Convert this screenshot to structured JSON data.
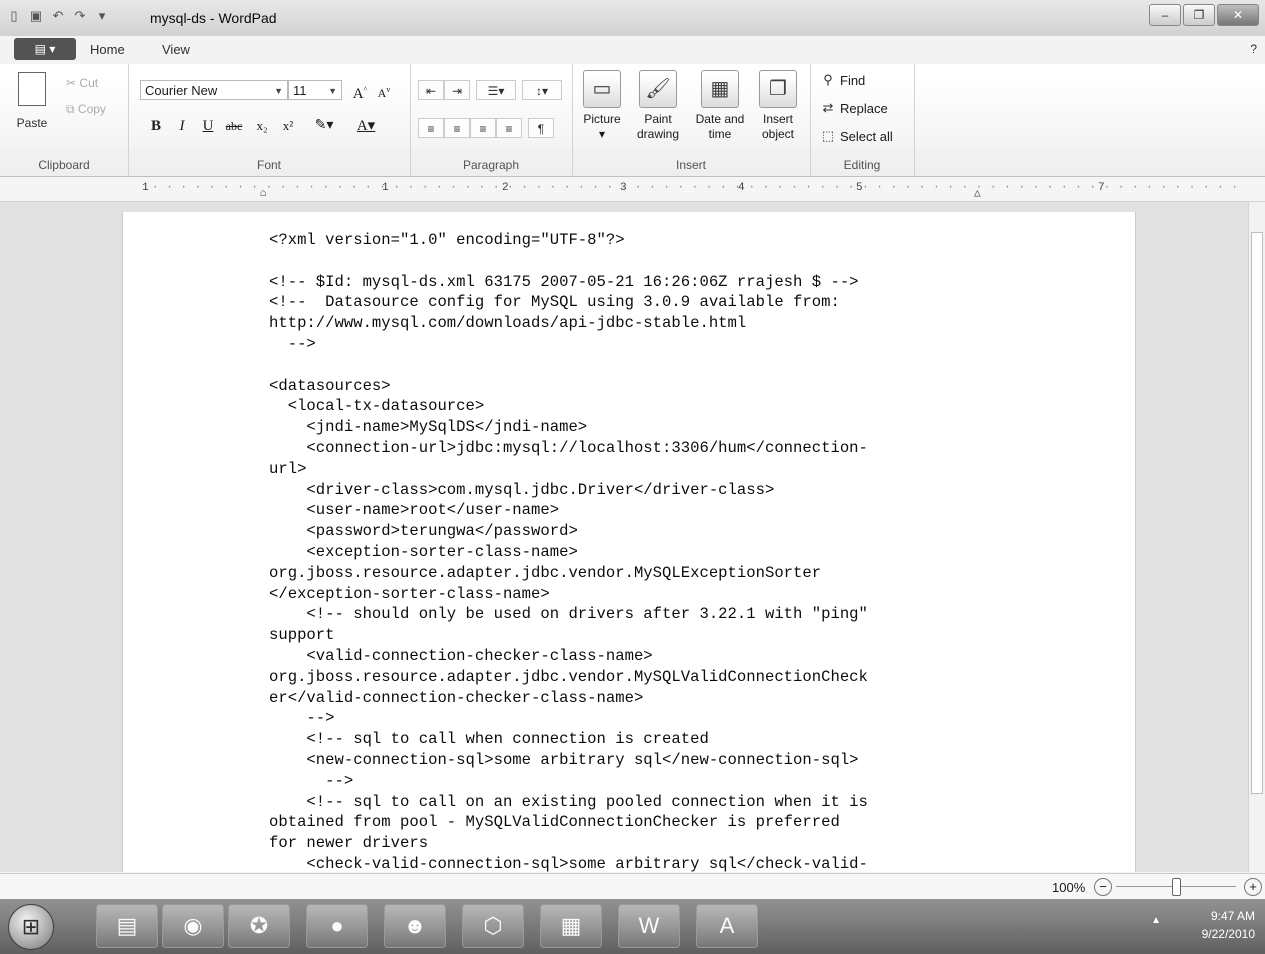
{
  "window": {
    "title": "mysql-ds - WordPad"
  },
  "tabs": {
    "home": "Home",
    "view": "View"
  },
  "ribbon": {
    "clipboard": {
      "paste": "Paste",
      "cut": "Cut",
      "copy": "Copy",
      "label": "Clipboard"
    },
    "font": {
      "family": "Courier New",
      "size": "11",
      "label": "Font"
    },
    "paragraph": {
      "label": "Paragraph"
    },
    "insert": {
      "picture": "Picture",
      "paint_drawing": "Paint drawing",
      "date_time": "Date and time",
      "insert_object": "Insert object",
      "label": "Insert"
    },
    "editing": {
      "find": "Find",
      "replace": "Replace",
      "select_all": "Select all",
      "label": "Editing"
    }
  },
  "ruler": {
    "numbers": [
      "1",
      "1",
      "2",
      "3",
      "4",
      "5",
      "7"
    ]
  },
  "document": {
    "lines": [
      "<?xml version=\"1.0\" encoding=\"UTF-8\"?>",
      "",
      "<!-- $Id: mysql-ds.xml 63175 2007-05-21 16:26:06Z rrajesh $ -->",
      "<!--  Datasource config for MySQL using 3.0.9 available from:",
      "http://www.mysql.com/downloads/api-jdbc-stable.html",
      "  -->",
      "",
      "<datasources>",
      "  <local-tx-datasource>",
      "    <jndi-name>MySqlDS</jndi-name>",
      "    <connection-url>jdbc:mysql://localhost:3306/hum</connection-",
      "url>",
      "    <driver-class>com.mysql.jdbc.Driver</driver-class>",
      "    <user-name>root</user-name>",
      "    <password>terungwa</password>",
      "    <exception-sorter-class-name>",
      "org.jboss.resource.adapter.jdbc.vendor.MySQLExceptionSorter",
      "</exception-sorter-class-name>",
      "    <!-- should only be used on drivers after 3.22.1 with \"ping\"",
      "support",
      "    <valid-connection-checker-class-name>",
      "org.jboss.resource.adapter.jdbc.vendor.MySQLValidConnectionCheck",
      "er</valid-connection-checker-class-name>",
      "    -->",
      "    <!-- sql to call when connection is created",
      "    <new-connection-sql>some arbitrary sql</new-connection-sql>",
      "      -->",
      "    <!-- sql to call on an existing pooled connection when it is",
      "obtained from pool - MySQLValidConnectionChecker is preferred",
      "for newer drivers",
      "    <check-valid-connection-sql>some arbitrary sql</check-valid-"
    ]
  },
  "status": {
    "zoom": "100%",
    "zoom_fraction": 0.5
  },
  "taskbar": {
    "time": "9:47 AM",
    "date": "9/22/2010"
  }
}
